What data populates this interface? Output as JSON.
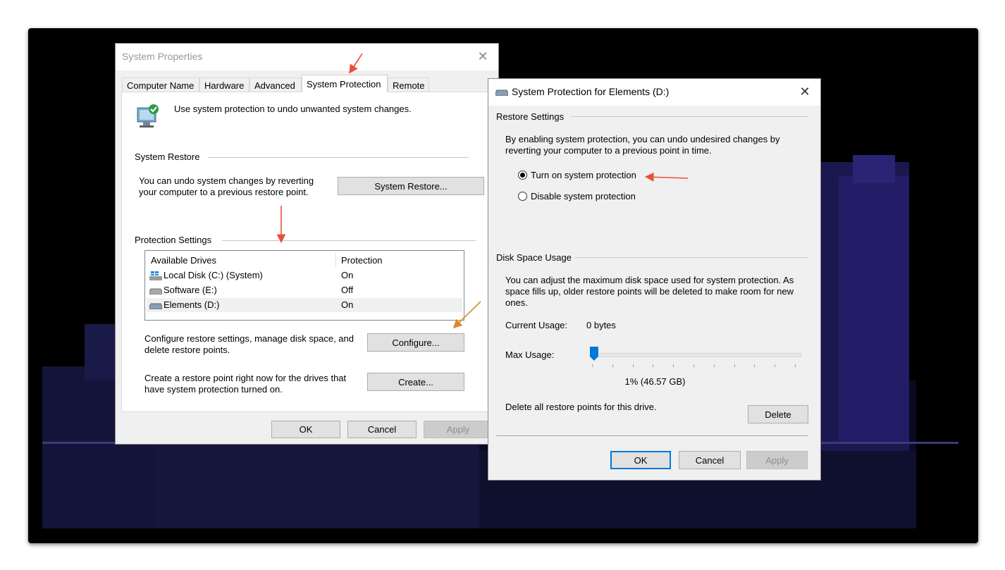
{
  "sysprops": {
    "title": "System Properties",
    "tabs": [
      "Computer Name",
      "Hardware",
      "Advanced",
      "System Protection",
      "Remote"
    ],
    "active_tab": "System Protection",
    "intro": "Use system protection to undo unwanted system changes.",
    "system_restore": {
      "group_label": "System Restore",
      "description_line1": "You can undo system changes by reverting",
      "description_line2": "your computer to a previous restore point.",
      "button": "System Restore..."
    },
    "protection": {
      "group_label": "Protection Settings",
      "col_drives": "Available Drives",
      "col_protection": "Protection",
      "drives": [
        {
          "name": "Local Disk (C:) (System)",
          "protection": "On"
        },
        {
          "name": "Software (E:)",
          "protection": "Off"
        },
        {
          "name": "Elements (D:)",
          "protection": "On"
        }
      ],
      "configure_line1": "Configure restore settings, manage disk space, and",
      "configure_line2": "delete restore points.",
      "configure_button": "Configure...",
      "create_line1": "Create a restore point right now for the drives that",
      "create_line2": "have system protection turned on.",
      "create_button": "Create..."
    },
    "buttons": {
      "ok": "OK",
      "cancel": "Cancel",
      "apply": "Apply"
    }
  },
  "spdlg": {
    "title": "System Protection for Elements (D:)",
    "restore_settings": {
      "group_label": "Restore Settings",
      "line1": "By enabling system protection, you can undo undesired changes by",
      "line2": "reverting your computer to a previous point in time.",
      "option_on": "Turn on system protection",
      "option_off": "Disable system protection",
      "selected": "on"
    },
    "disk_space": {
      "group_label": "Disk Space Usage",
      "line1": "You can adjust the maximum disk space used for system protection. As",
      "line2": "space fills up, older restore points will be deleted to make room for new",
      "line3": "ones.",
      "current_label": "Current Usage:",
      "current_value": "0 bytes",
      "max_label": "Max Usage:",
      "max_value_text": "1% (46.57 GB)",
      "max_percent": 1,
      "delete_text": "Delete all restore points for this drive.",
      "delete_button": "Delete"
    },
    "buttons": {
      "ok": "OK",
      "cancel": "Cancel",
      "apply": "Apply"
    }
  },
  "colors": {
    "accent": "#0078d7",
    "annotation_red": "#e8503a",
    "annotation_orange": "#d98b2b"
  }
}
